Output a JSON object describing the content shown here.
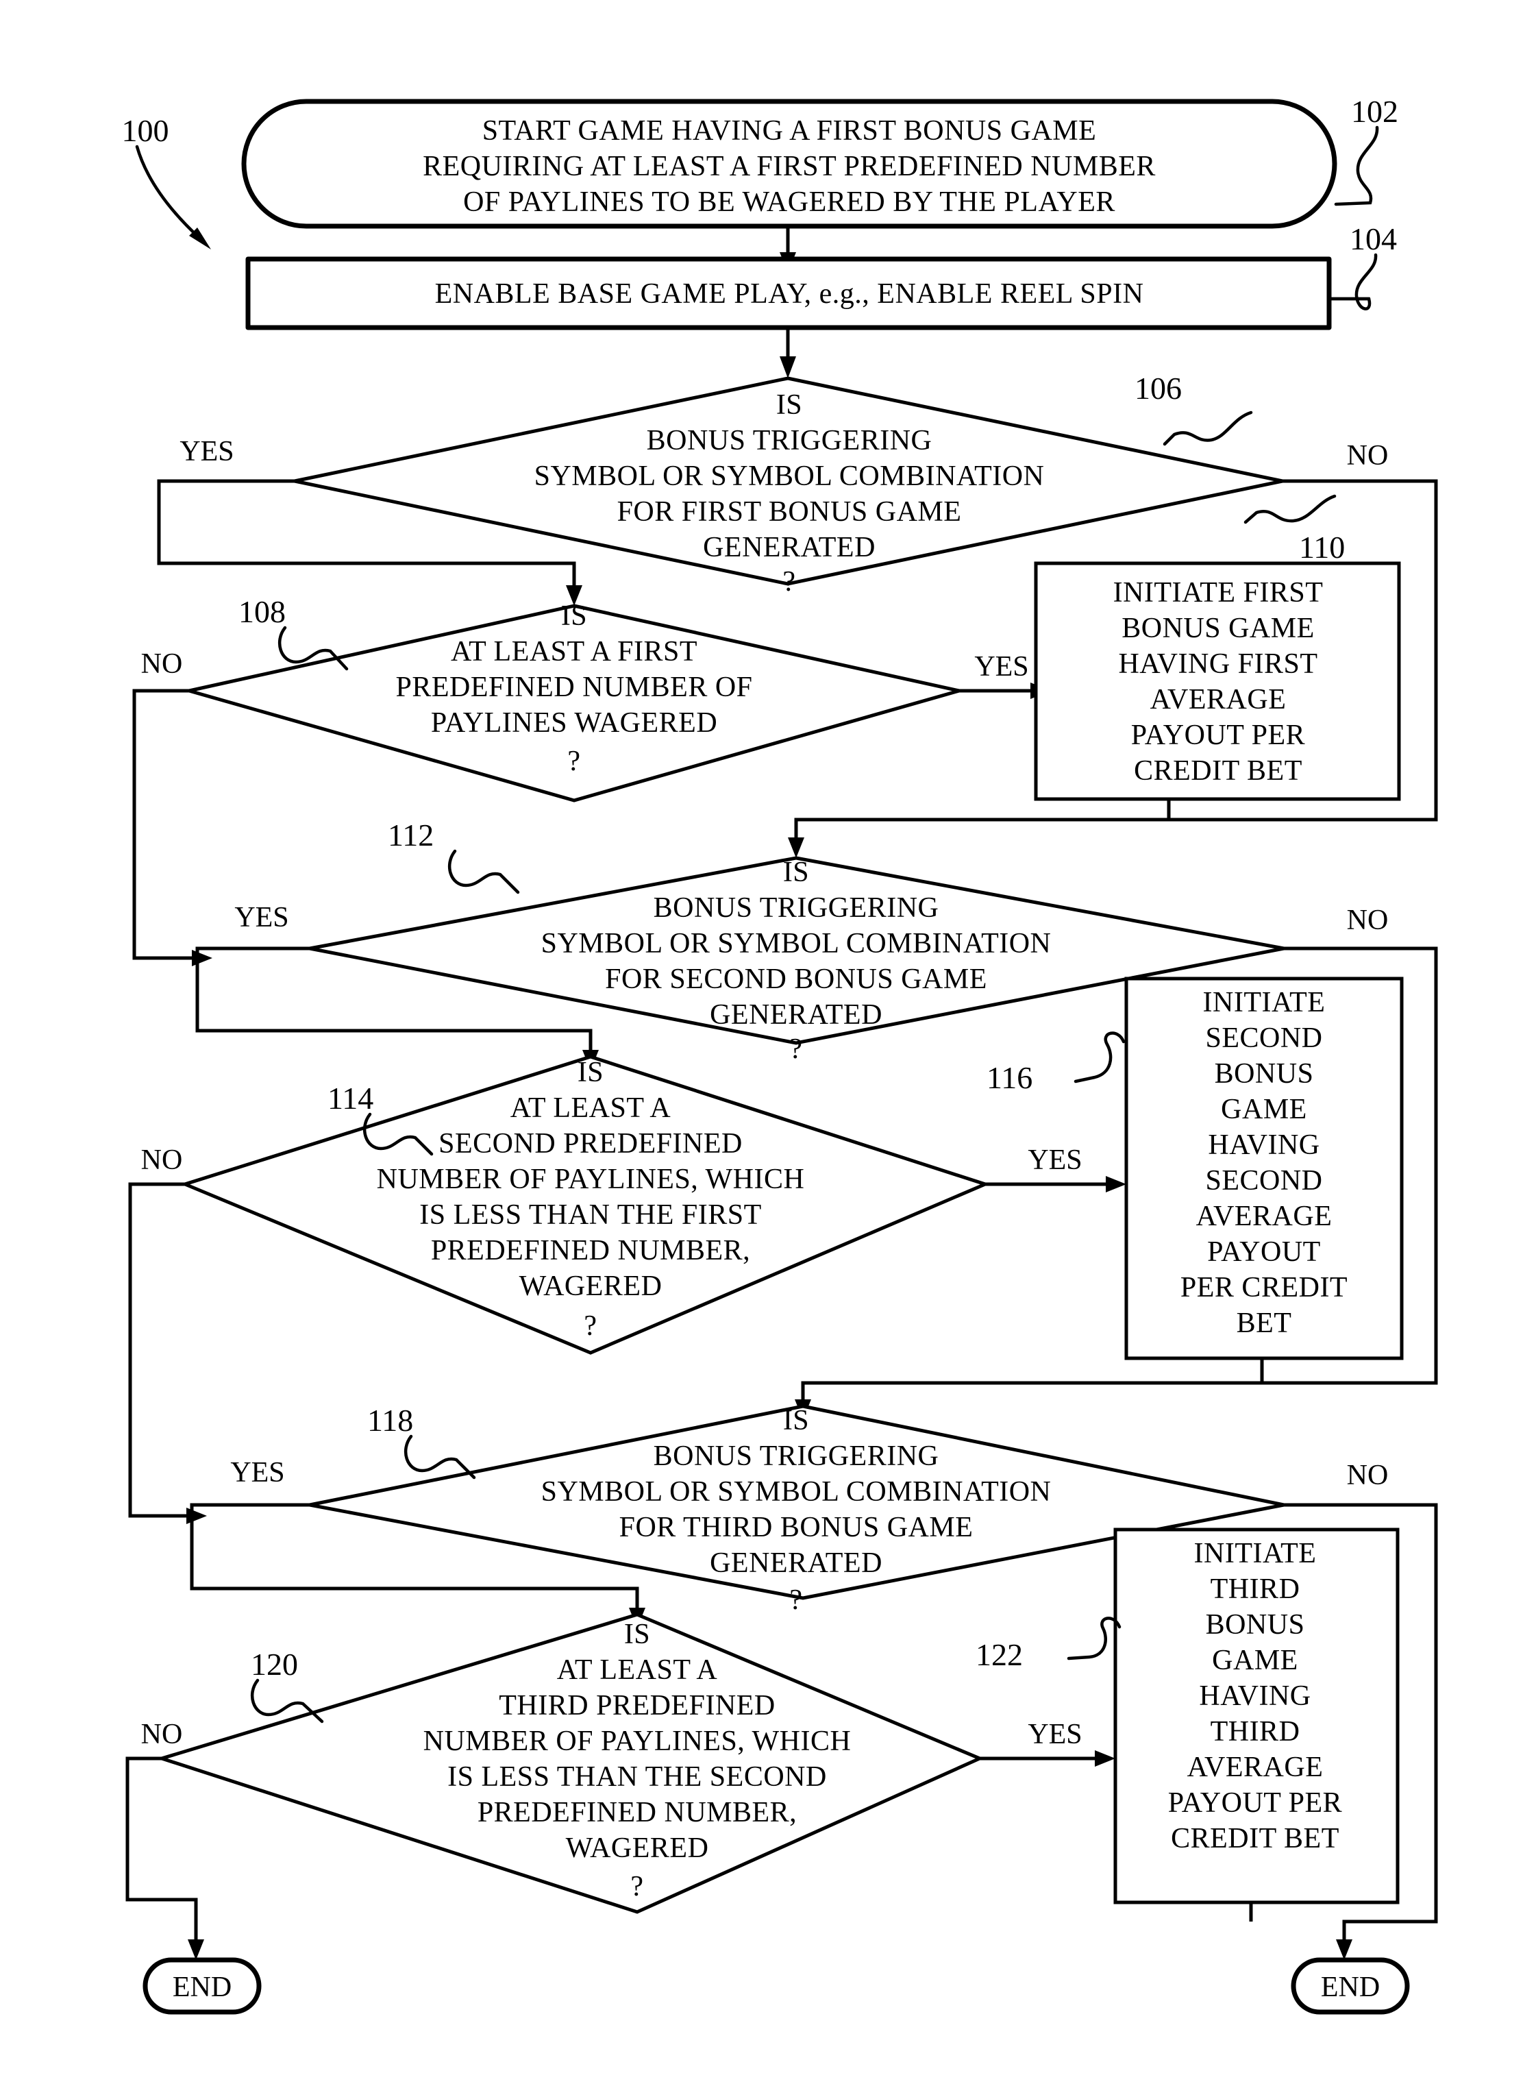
{
  "figure": {
    "type": "patent-flowchart",
    "overall_ref": "100"
  },
  "nodes": {
    "start": {
      "ref": "102",
      "shape": "rounded-terminal",
      "lines": [
        "START GAME HAVING A FIRST BONUS GAME",
        "REQUIRING AT LEAST A FIRST PREDEFINED NUMBER",
        "OF PAYLINES TO BE WAGERED BY THE PLAYER"
      ]
    },
    "enable": {
      "ref": "104",
      "shape": "process",
      "lines": [
        "ENABLE BASE GAME PLAY, e.g., ENABLE REEL SPIN"
      ]
    },
    "d106": {
      "ref": "106",
      "shape": "decision",
      "lines": [
        "IS",
        "BONUS TRIGGERING",
        "SYMBOL OR SYMBOL COMBINATION",
        "FOR FIRST BONUS GAME",
        "GENERATED",
        "?"
      ],
      "yes_label": "YES",
      "no_label": "NO"
    },
    "d108": {
      "ref": "108",
      "shape": "decision",
      "lines": [
        "IS",
        "AT LEAST A FIRST",
        "PREDEFINED NUMBER OF",
        "PAYLINES WAGERED",
        "?"
      ],
      "yes_label": "YES",
      "no_label": "NO"
    },
    "b110": {
      "ref": "110",
      "shape": "process",
      "lines": [
        "INITIATE FIRST",
        "BONUS GAME",
        "HAVING FIRST",
        "AVERAGE",
        "PAYOUT PER",
        "CREDIT BET"
      ]
    },
    "d112": {
      "ref": "112",
      "shape": "decision",
      "lines": [
        "IS",
        "BONUS TRIGGERING",
        "SYMBOL OR SYMBOL COMBINATION",
        "FOR SECOND BONUS GAME",
        "GENERATED",
        "?"
      ],
      "yes_label": "YES",
      "no_label": "NO"
    },
    "d114": {
      "ref": "114",
      "shape": "decision",
      "lines": [
        "IS",
        "AT LEAST A",
        "SECOND PREDEFINED",
        "NUMBER OF PAYLINES, WHICH",
        "IS LESS THAN THE FIRST",
        "PREDEFINED NUMBER,",
        "WAGERED",
        "?"
      ],
      "yes_label": "YES",
      "no_label": "NO"
    },
    "b116": {
      "ref": "116",
      "shape": "process",
      "lines": [
        "INITIATE",
        "SECOND",
        "BONUS",
        "GAME",
        "HAVING",
        "SECOND",
        "AVERAGE",
        "PAYOUT",
        "PER CREDIT",
        "BET"
      ]
    },
    "d118": {
      "ref": "118",
      "shape": "decision",
      "lines": [
        "IS",
        "BONUS TRIGGERING",
        "SYMBOL OR SYMBOL COMBINATION",
        "FOR THIRD BONUS GAME",
        "GENERATED",
        "?"
      ],
      "yes_label": "YES",
      "no_label": "NO"
    },
    "d120": {
      "ref": "120",
      "shape": "decision",
      "lines": [
        "IS",
        "AT LEAST A",
        "THIRD PREDEFINED",
        "NUMBER OF PAYLINES, WHICH",
        "IS LESS THAN THE SECOND",
        "PREDEFINED NUMBER,",
        "WAGERED",
        "?"
      ],
      "yes_label": "YES",
      "no_label": "NO"
    },
    "b122": {
      "ref": "122",
      "shape": "process",
      "lines": [
        "INITIATE",
        "THIRD",
        "BONUS",
        "GAME",
        "HAVING",
        "THIRD",
        "AVERAGE",
        "PAYOUT PER",
        "CREDIT BET"
      ]
    },
    "end_left": {
      "shape": "rounded-terminal",
      "label": "END"
    },
    "end_right": {
      "shape": "rounded-terminal",
      "label": "END"
    }
  },
  "text": {
    "start_l1": "START GAME HAVING A FIRST BONUS GAME",
    "start_l2": "REQUIRING AT LEAST A FIRST PREDEFINED NUMBER",
    "start_l3": "OF PAYLINES TO BE WAGERED BY THE PLAYER",
    "enable_l1": "ENABLE BASE GAME PLAY, e.g., ENABLE REEL SPIN",
    "d106_l1": "IS",
    "d106_l2": "BONUS TRIGGERING",
    "d106_l3": "SYMBOL OR SYMBOL COMBINATION",
    "d106_l4": "FOR FIRST BONUS GAME",
    "d106_l5": "GENERATED",
    "d106_l6": "?",
    "d108_l1": "IS",
    "d108_l2": "AT LEAST A FIRST",
    "d108_l3": "PREDEFINED NUMBER OF",
    "d108_l4": "PAYLINES WAGERED",
    "d108_l5": "?",
    "b110_l1": "INITIATE FIRST",
    "b110_l2": "BONUS GAME",
    "b110_l3": "HAVING FIRST",
    "b110_l4": "AVERAGE",
    "b110_l5": "PAYOUT PER",
    "b110_l6": "CREDIT BET",
    "d112_l1": "IS",
    "d112_l2": "BONUS TRIGGERING",
    "d112_l3": "SYMBOL OR SYMBOL COMBINATION",
    "d112_l4": "FOR SECOND BONUS GAME",
    "d112_l5": "GENERATED",
    "d112_l6": "?",
    "d114_l1": "IS",
    "d114_l2": "AT LEAST A",
    "d114_l3": "SECOND PREDEFINED",
    "d114_l4": "NUMBER OF PAYLINES, WHICH",
    "d114_l5": "IS LESS THAN THE FIRST",
    "d114_l6": "PREDEFINED NUMBER,",
    "d114_l7": "WAGERED",
    "d114_l8": "?",
    "b116_l1": "INITIATE",
    "b116_l2": "SECOND",
    "b116_l3": "BONUS",
    "b116_l4": "GAME",
    "b116_l5": "HAVING",
    "b116_l6": "SECOND",
    "b116_l7": "AVERAGE",
    "b116_l8": "PAYOUT",
    "b116_l9": "PER CREDIT",
    "b116_l10": "BET",
    "d118_l1": "IS",
    "d118_l2": "BONUS TRIGGERING",
    "d118_l3": "SYMBOL OR SYMBOL COMBINATION",
    "d118_l4": "FOR THIRD BONUS GAME",
    "d118_l5": "GENERATED",
    "d118_l6": "?",
    "d120_l1": "IS",
    "d120_l2": "AT LEAST A",
    "d120_l3": "THIRD PREDEFINED",
    "d120_l4": "NUMBER OF PAYLINES, WHICH",
    "d120_l5": "IS LESS THAN THE SECOND",
    "d120_l6": "PREDEFINED NUMBER,",
    "d120_l7": "WAGERED",
    "d120_l8": "?",
    "b122_l1": "INITIATE",
    "b122_l2": "THIRD",
    "b122_l3": "BONUS",
    "b122_l4": "GAME",
    "b122_l5": "HAVING",
    "b122_l6": "THIRD",
    "b122_l7": "AVERAGE",
    "b122_l8": "PAYOUT PER",
    "b122_l9": "CREDIT BET",
    "end_label_left": "END",
    "end_label_right": "END"
  },
  "refs": {
    "r100": "100",
    "r102": "102",
    "r104": "104",
    "r106": "106",
    "r108": "108",
    "r110": "110",
    "r112": "112",
    "r114": "114",
    "r116": "116",
    "r118": "118",
    "r120": "120",
    "r122": "122"
  },
  "labels": {
    "yes106": "YES",
    "no106": "NO",
    "yes108": "YES",
    "no108": "NO",
    "yes112": "YES",
    "no112": "NO",
    "yes114": "YES",
    "no114": "NO",
    "yes118": "YES",
    "no118": "NO",
    "yes120": "YES",
    "no120": "NO"
  },
  "colors": {
    "ink": "#000000",
    "paper": "#ffffff"
  }
}
